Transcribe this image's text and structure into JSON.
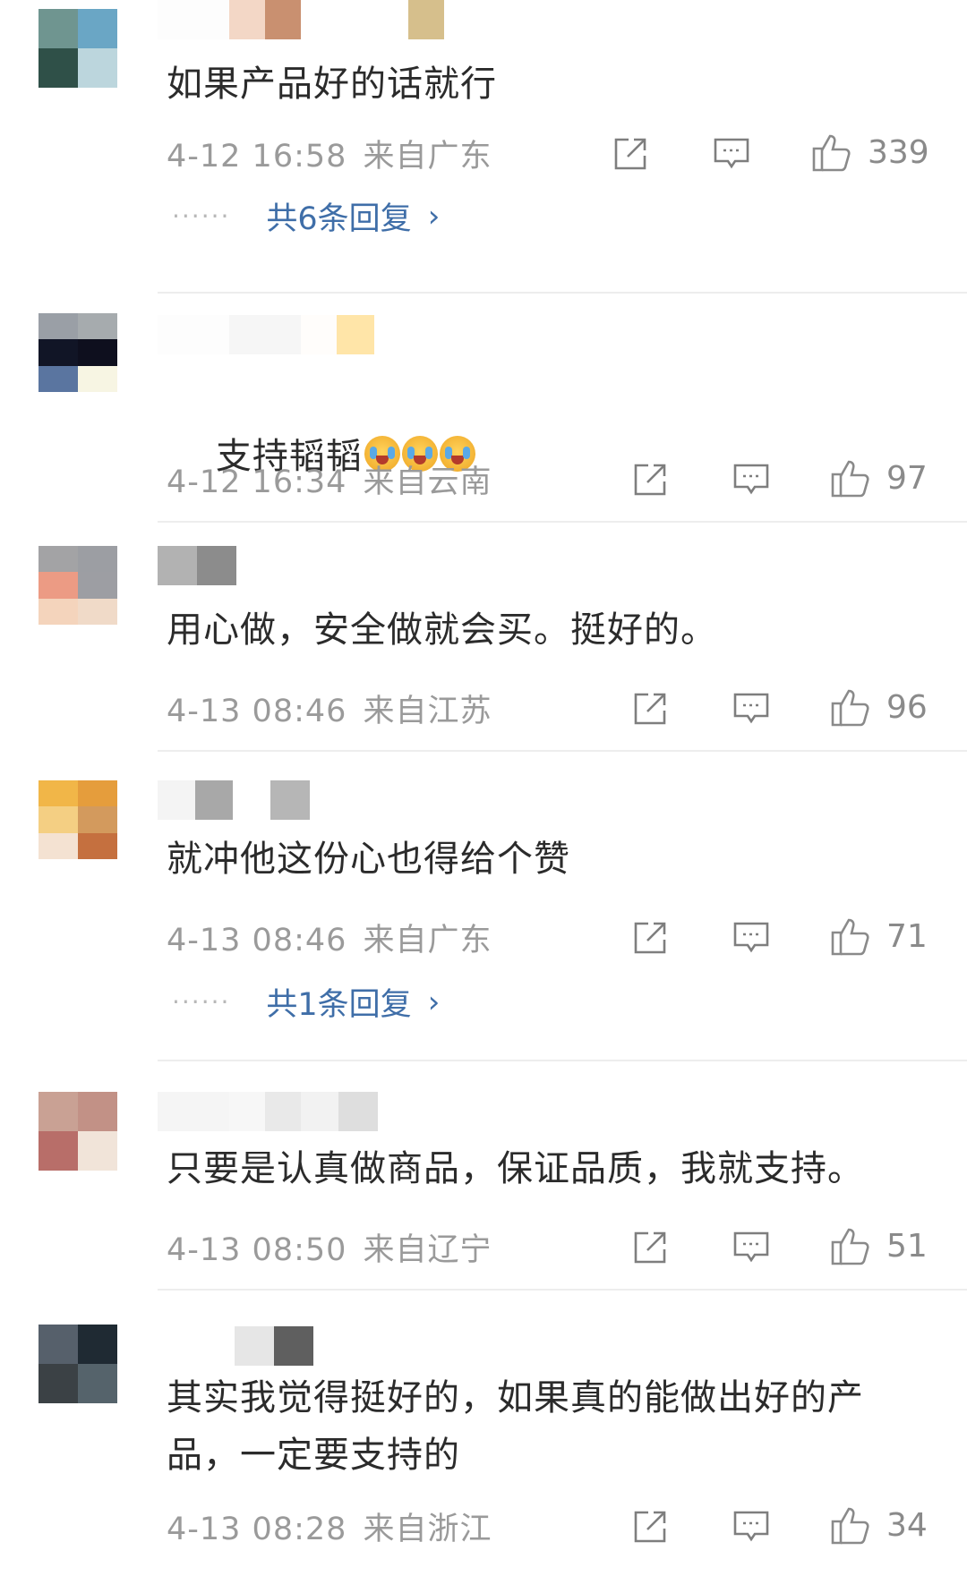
{
  "comments": [
    {
      "text": "如果产品好的话就行",
      "time": "4-12 16:58",
      "location": "来自广东",
      "likes": "339",
      "replies": "共6条回复",
      "avatar_colors": [
        "#6f9590",
        "#6aa6c5",
        "#2f5048",
        "#bcd6dd"
      ],
      "username_colors": [
        "#f3d7c6",
        "#c99070",
        "#fbfbfb",
        "#d6bf8c"
      ]
    },
    {
      "text": "支持韬韬",
      "emojis": 3,
      "time": "4-12 16:34",
      "location": "来自云南",
      "likes": "97",
      "replies": "",
      "avatar_colors": [
        "#9a9fa6",
        "#a6abae",
        "#111526",
        "#0e0f1e",
        "#5a75a0",
        "#f7f5e3"
      ],
      "username_colors": [
        "#fdfdfd",
        "#f6f6f6",
        "#ffe5a8"
      ]
    },
    {
      "text": "用心做，安全做就会买。挺好的。",
      "time": "4-13 08:46",
      "location": "来自江苏",
      "likes": "96",
      "replies": "",
      "avatar_colors": [
        "#a3a3a5",
        "#9c9ea3",
        "#ec9b84",
        "#9d9ea3",
        "#f4d4bc",
        "#f0dac8"
      ],
      "username_colors": [
        "#b2b2b2",
        "#8c8c8c"
      ]
    },
    {
      "text": "就冲他这份心也得给个赞",
      "time": "4-13 08:46",
      "location": "来自广东",
      "likes": "71",
      "replies": "共1条回复",
      "avatar_colors": [
        "#f1b648",
        "#e59d3c",
        "#f4cf83",
        "#d39a5d",
        "#f4e2d2",
        "#c5703f"
      ],
      "username_colors": [
        "#f4f4f4",
        "#a8a8a8",
        "#ffffff",
        "#b6b6b6"
      ]
    },
    {
      "text": "只要是认真做商品，保证品质，我就支持。",
      "time": "4-13 08:50",
      "location": "来自辽宁",
      "likes": "51",
      "replies": "",
      "avatar_colors": [
        "#c9a194",
        "#c29186",
        "#b86e69",
        "#f1e4d9"
      ],
      "username_colors": [
        "#f5f5f5",
        "#f7f7f7",
        "#e9e9e9",
        "#f2f2f2",
        "#dedede"
      ]
    },
    {
      "text": "其实我觉得挺好的，如果真的能做出好的产品，一定要支持的",
      "time": "4-13 08:28",
      "location": "来自浙江",
      "likes": "34",
      "replies": "",
      "avatar_colors": [
        "#56606b",
        "#1f2a33",
        "#3b4145",
        "#55636b"
      ],
      "username_colors": [
        "#ffffff",
        "#e6e6e6",
        "#5f5f5f"
      ]
    }
  ]
}
